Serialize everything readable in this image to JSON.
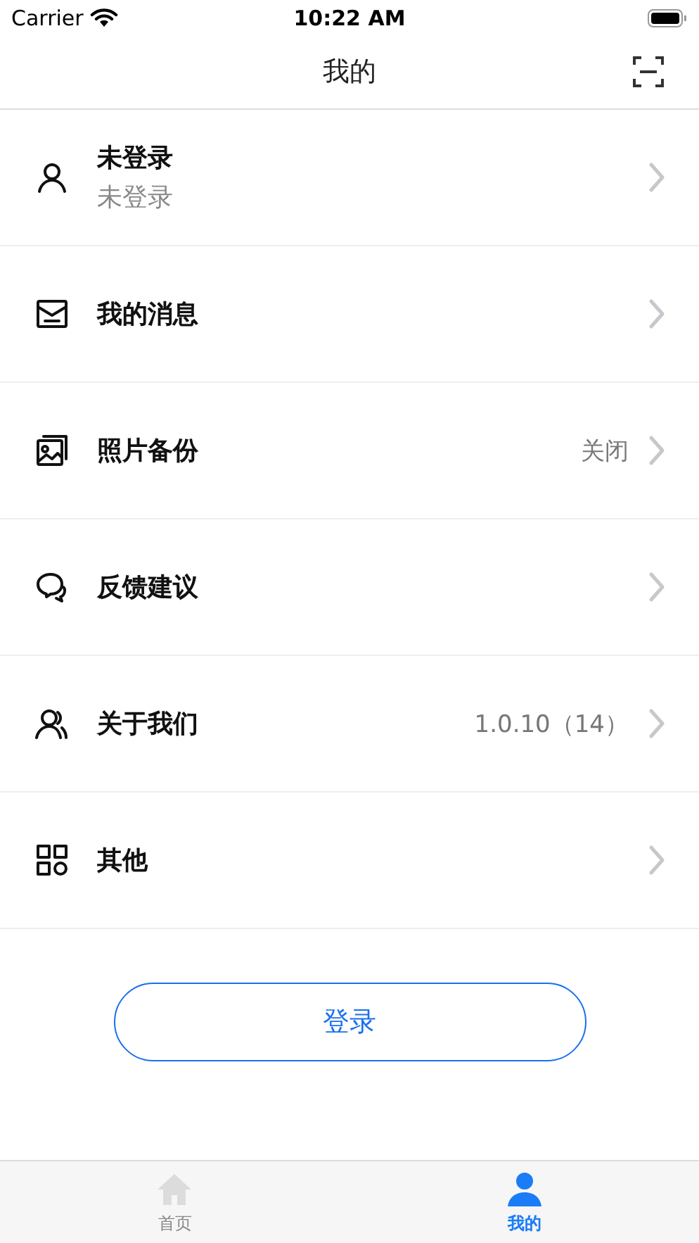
{
  "status_bar": {
    "carrier": "Carrier",
    "time": "10:22 AM"
  },
  "nav_bar": {
    "title": "我的"
  },
  "menu": [
    {
      "kind": "person",
      "label": "未登录",
      "subtitle": "未登录"
    },
    {
      "kind": "mail",
      "label": "我的消息"
    },
    {
      "kind": "photo",
      "label": "照片备份",
      "value": "关闭"
    },
    {
      "kind": "chat",
      "label": "反馈建议"
    },
    {
      "kind": "people",
      "label": "关于我们",
      "value": "1.0.10（14）"
    },
    {
      "kind": "grid",
      "label": "其他"
    }
  ],
  "login_button": "登录",
  "tab_bar": [
    {
      "kind": "home",
      "label": "首页",
      "selected": false
    },
    {
      "kind": "user",
      "label": "我的",
      "selected": true
    }
  ]
}
